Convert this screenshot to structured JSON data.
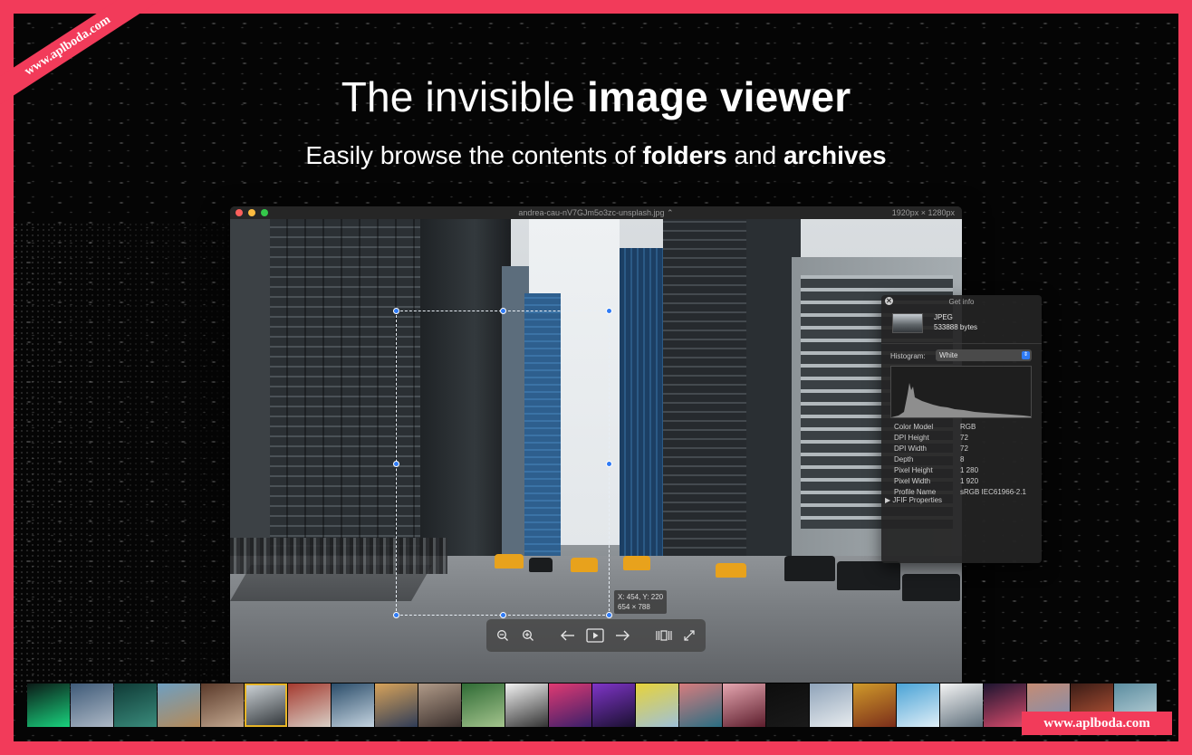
{
  "headline": {
    "regular": "The invisible ",
    "bold": "image viewer"
  },
  "subline": {
    "part1": "Easily browse the contents of ",
    "bold1": "folders",
    "part2": " and ",
    "bold2": "archives"
  },
  "window": {
    "title": "andrea-cau-nV7GJm5o3zc-unsplash.jpg",
    "title_chevron": "⌃",
    "dimensions": "1920px × 1280px"
  },
  "selection": {
    "coords": "X: 454, Y: 220",
    "size": "654 × 788"
  },
  "toolbar": {
    "zoom_out": "zoom-out-icon",
    "zoom_in": "zoom-in-icon",
    "previous": "arrow-left-icon",
    "slideshow": "play-icon",
    "next": "arrow-right-icon",
    "filmstrip": "filmstrip-icon",
    "fullscreen": "fullscreen-icon"
  },
  "info_panel": {
    "title": "Get info",
    "close_glyph": "✕",
    "file_type": "JPEG",
    "file_size": "533888 bytes",
    "histogram_label": "Histogram:",
    "histogram_mode": "White",
    "properties": [
      {
        "key": "Color Model",
        "value": "RGB"
      },
      {
        "key": "DPI Height",
        "value": "72"
      },
      {
        "key": "DPI Width",
        "value": "72"
      },
      {
        "key": "Depth",
        "value": "8"
      },
      {
        "key": "Pixel Height",
        "value": "1 280"
      },
      {
        "key": "Pixel Width",
        "value": "1 920"
      },
      {
        "key": "Profile Name",
        "value": "sRGB IEC61966-2.1"
      }
    ],
    "jfif_label": "▶ JFIF Properties"
  },
  "filmstrip": {
    "selected_index": 5,
    "thumbnails": [
      {
        "name": "chart-glow",
        "colors": [
          "#0c1a17",
          "#19d37e"
        ]
      },
      {
        "name": "glass-building",
        "colors": [
          "#3e5a78",
          "#aeb9c6"
        ]
      },
      {
        "name": "hex-pattern",
        "colors": [
          "#0f3a36",
          "#3a8c7c"
        ]
      },
      {
        "name": "canyon-road",
        "colors": [
          "#6e9fc1",
          "#b58a58"
        ]
      },
      {
        "name": "old-street",
        "colors": [
          "#5b3a2a",
          "#c3a890"
        ]
      },
      {
        "name": "city-street",
        "colors": [
          "#d0d6da",
          "#2d3236"
        ]
      },
      {
        "name": "red-house",
        "colors": [
          "#a53a2f",
          "#d8cfc6"
        ]
      },
      {
        "name": "sea-rocks",
        "colors": [
          "#2b4d6a",
          "#c5d4e0"
        ]
      },
      {
        "name": "abstract-swirl",
        "colors": [
          "#d8a35a",
          "#2f3c57"
        ]
      },
      {
        "name": "skyline",
        "colors": [
          "#b09a88",
          "#3a2f2c"
        ]
      },
      {
        "name": "green-tower",
        "colors": [
          "#2f6b35",
          "#a4c48d"
        ]
      },
      {
        "name": "geometric-lines",
        "colors": [
          "#f2f2f2",
          "#333333"
        ]
      },
      {
        "name": "neon-corridor",
        "colors": [
          "#e03a72",
          "#3a1f6a"
        ]
      },
      {
        "name": "purple-tunnel",
        "colors": [
          "#7f35c8",
          "#1a1030"
        ]
      },
      {
        "name": "yellow-field",
        "colors": [
          "#e7d33a",
          "#9fc1d9"
        ]
      },
      {
        "name": "mountain-lake",
        "colors": [
          "#d77c7e",
          "#2a6e82"
        ]
      },
      {
        "name": "pink-phone",
        "colors": [
          "#e5a6b0",
          "#5c1d2c"
        ]
      },
      {
        "name": "dark",
        "colors": [
          "#0d0d0d",
          "#1a1a1a"
        ]
      },
      {
        "name": "snow-peak",
        "colors": [
          "#8fa3b9",
          "#e8ecef"
        ]
      },
      {
        "name": "autumn-tree",
        "colors": [
          "#d09a2a",
          "#7a2d1a"
        ]
      },
      {
        "name": "blue-building",
        "colors": [
          "#4aa3d6",
          "#dfeef7"
        ]
      },
      {
        "name": "white-petals",
        "colors": [
          "#f4f4f4",
          "#5e6e7a"
        ]
      },
      {
        "name": "night-street",
        "colors": [
          "#1d1530",
          "#d84b6b"
        ]
      },
      {
        "name": "desert-sky",
        "colors": [
          "#c58c74",
          "#7a8eb5"
        ]
      },
      {
        "name": "red-dome",
        "colors": [
          "#3a1c16",
          "#c45a3a"
        ]
      },
      {
        "name": "teal-sea",
        "colors": [
          "#5b8da0",
          "#c7d9de"
        ]
      }
    ]
  },
  "watermark": {
    "ribbon": "www.aplboda.com",
    "box": "www.aplboda.com"
  }
}
